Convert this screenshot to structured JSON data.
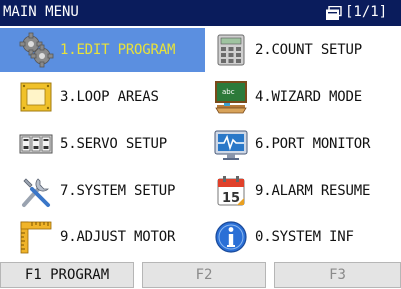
{
  "title": "MAIN MENU",
  "page_indicator": "[1/1]",
  "menu": [
    {
      "label": "1.EDIT PROGRAM",
      "icon": "gears-icon",
      "selected": true
    },
    {
      "label": "2.COUNT SETUP",
      "icon": "calculator-icon",
      "selected": false
    },
    {
      "label": "3.LOOP AREAS",
      "icon": "loop-frame-icon",
      "selected": false
    },
    {
      "label": "4.WIZARD MODE",
      "icon": "blackboard-icon",
      "selected": false
    },
    {
      "label": "5.SERVO SETUP",
      "icon": "servo-drives-icon",
      "selected": false
    },
    {
      "label": "6.PORT MONITOR",
      "icon": "monitor-wave-icon",
      "selected": false
    },
    {
      "label": "7.SYSTEM SETUP",
      "icon": "tools-icon",
      "selected": false
    },
    {
      "label": "9.ALARM RESUME",
      "icon": "calendar-icon",
      "selected": false
    },
    {
      "label": "9.ADJUST MOTOR",
      "icon": "ruler-icon",
      "selected": false
    },
    {
      "label": "0.SYSTEM INF",
      "icon": "info-icon",
      "selected": false
    }
  ],
  "calendar_icon_day": "15",
  "function_keys": [
    {
      "label": "F1 PROGRAM",
      "enabled": true
    },
    {
      "label": "F2",
      "enabled": false
    },
    {
      "label": "F3",
      "enabled": false
    }
  ],
  "colors": {
    "titlebar": "#0a1c5c",
    "selected_bg": "#5b8fe0",
    "selected_text": "#e8e23a"
  }
}
